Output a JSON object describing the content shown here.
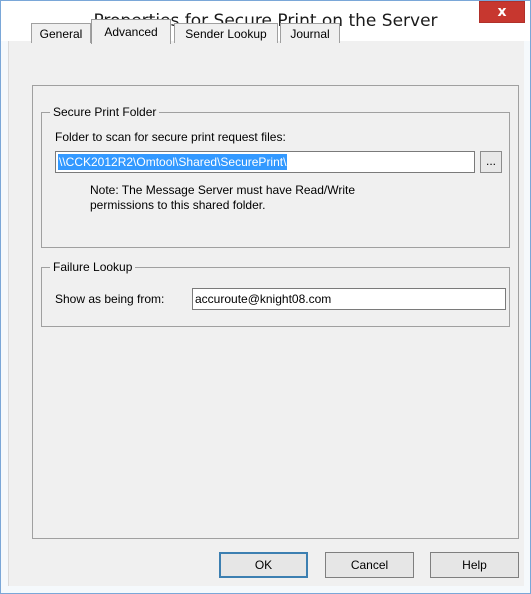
{
  "window": {
    "title": "Properties for Secure Print on the Server",
    "close_glyph": "x"
  },
  "tabs": [
    {
      "label": "General",
      "active": false
    },
    {
      "label": "Advanced",
      "active": true
    },
    {
      "label": "Sender Lookup",
      "active": false
    },
    {
      "label": "Journal",
      "active": false
    }
  ],
  "secure_print_folder": {
    "group_title": "Secure Print Folder",
    "field_label": "Folder to scan for secure print request files:",
    "path_value": "\\\\CCK2012R2\\Omtool\\Shared\\SecurePrint\\",
    "browse_label": "...",
    "note_line1": "Note: The Message Server must have Read/Write",
    "note_line2": "permissions to this shared folder."
  },
  "failure_lookup": {
    "group_title": "Failure Lookup",
    "field_label": "Show as being from:",
    "from_value": "accuroute@knight08.com"
  },
  "buttons": {
    "ok": "OK",
    "cancel": "Cancel",
    "help": "Help"
  },
  "colors": {
    "selection": "#3399ff",
    "close_button": "#c7372f",
    "window_border": "#7aa7d8"
  }
}
